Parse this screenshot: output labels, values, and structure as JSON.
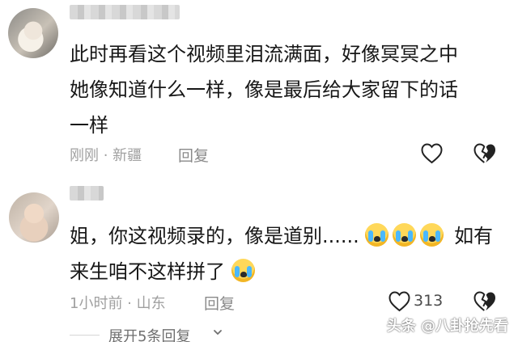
{
  "comments": [
    {
      "text_lines": [
        "此时再看这个视频里泪流满面，好像冥冥之中",
        "她像知道什么一样，像是最后给大家留下的话",
        "一样"
      ],
      "meta": "刚刚 · 新疆",
      "reply_label": "回复"
    },
    {
      "text_line_1_before_emojis": "姐，你这视频录的，像是道别......",
      "text_line_1_after_emojis": "如有",
      "text_line_2_before_emoji": "来生咱不这样拼了",
      "meta": "1小时前 · 山东",
      "reply_label": "回复",
      "like_count": "313",
      "expand_label": "展开5条回复"
    }
  ],
  "watermark": "头条 @八卦抢先看",
  "icons": {
    "heart": "heart-icon",
    "broken_heart": "broken-heart-icon",
    "crying_emoji": "crying-face-emoji",
    "chevron": "chevron-down-icon"
  },
  "colors": {
    "text": "#171717",
    "meta": "#a0a0a0",
    "reply": "#8a8a8a",
    "emoji_yellow": "#ffd85a",
    "tear_blue": "#4ab8ff"
  }
}
